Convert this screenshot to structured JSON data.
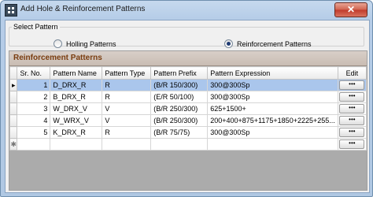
{
  "window": {
    "title": "Add Hole & Reinforcement Patterns",
    "close_label": "✕"
  },
  "select_pattern": {
    "legend": "Select Pattern",
    "option_holling": "Holling Patterns",
    "option_reinforcement": "Reinforcement Patterns",
    "selected": "Reinforcement Patterns"
  },
  "grid": {
    "caption": "Reinforcement Patterns",
    "columns": [
      "Sr. No.",
      "Pattern Name",
      "Pattern Type",
      "Pattern Prefix",
      "Pattern Expression",
      "Edit"
    ],
    "rows": [
      {
        "sr": "1",
        "name": "D_DRX_R",
        "type": "R",
        "prefix": "(B/R 150/300)",
        "expression": "300@300Sp",
        "edit": "•••"
      },
      {
        "sr": "2",
        "name": "B_DRX_R",
        "type": "R",
        "prefix": "(E/R 50/100)",
        "expression": "300@300Sp",
        "edit": "•••"
      },
      {
        "sr": "3",
        "name": "W_DRX_V",
        "type": "V",
        "prefix": "(B/R 250/300)",
        "expression": "625+1500+",
        "edit": "•••"
      },
      {
        "sr": "4",
        "name": "W_WRX_V",
        "type": "V",
        "prefix": "(B/R 250/300)",
        "expression": "200+400+875+1175+1850+2225+255...",
        "edit": "•••"
      },
      {
        "sr": "5",
        "name": "K_DRX_R",
        "type": "R",
        "prefix": "(B/R 75/75)",
        "expression": "300@300Sp",
        "edit": "•••"
      }
    ],
    "new_row_edit": "•••",
    "current_row_marker": "▸",
    "new_row_marker": "✱"
  },
  "colors": {
    "selection": "#aac6ec",
    "caption_text": "#7a3d10",
    "radio_dot": "#1f3b73"
  }
}
